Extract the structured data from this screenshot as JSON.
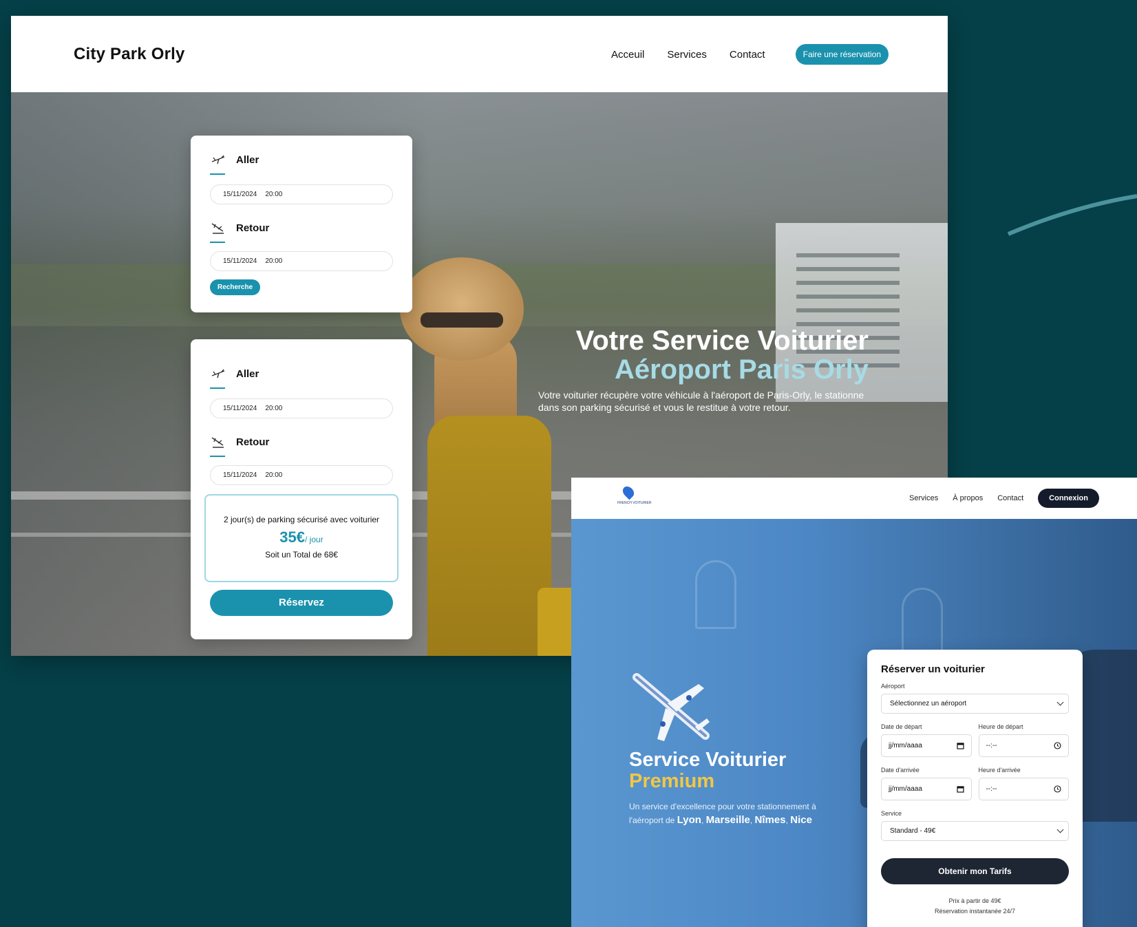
{
  "citypark": {
    "logo": "City Park Orly",
    "nav": [
      "Acceuil",
      "Services",
      "Contact"
    ],
    "cta": "Faire une réservation",
    "card1": {
      "aller_label": "Aller",
      "aller_date": "15/11/2024",
      "aller_time": "20:00",
      "retour_label": "Retour",
      "retour_date": "15/11/2024",
      "retour_time": "20:00",
      "search_button": "Recherche"
    },
    "card2": {
      "aller_label": "Aller",
      "aller_date": "15/11/2024",
      "aller_time": "20:00",
      "retour_label": "Retour",
      "retour_date": "15/11/2024",
      "retour_time": "20:00",
      "summary": "2 jour(s) de parking sécurisé avec voiturier",
      "price": "35€",
      "price_unit": "/ jour",
      "total": "Soit un Total de 68€",
      "reserve_button": "Réservez"
    },
    "hero_title_1": "Votre Service Voiturier",
    "hero_title_2": "Aéroport Paris Orly",
    "hero_subtitle": "Votre voiturier récupère votre véhicule à l'aéroport de Paris-Orly, le stationne dans son parking sécurisé et vous le restitue à votre retour.",
    "accent_color": "#1a92ad"
  },
  "frenchvoiturier": {
    "logo_text": "FRENCH VOITURIER",
    "nav": [
      "Services",
      "À propos",
      "Contact"
    ],
    "login_button": "Connexion",
    "hero_title_1": "Service Voiturier",
    "hero_title_2": "Premium",
    "hero_sub_prefix": "Un service d'excellence pour votre stationnement à l'aéroport de",
    "cities": [
      "Lyon",
      "Marseille",
      "Nîmes",
      "Nice"
    ],
    "form": {
      "title": "Réserver un voiturier",
      "airport_label": "Aéroport",
      "airport_value": "Sélectionnez un aéroport",
      "depart_date_label": "Date de départ",
      "depart_date_value": "jj/mm/aaaa",
      "depart_time_label": "Heure de départ",
      "depart_time_value": "--:--",
      "arrive_date_label": "Date d'arrivée",
      "arrive_date_value": "jj/mm/aaaa",
      "arrive_time_label": "Heure d'arrivée",
      "arrive_time_value": "--:--",
      "service_label": "Service",
      "service_value": "Standard - 49€",
      "submit_button": "Obtenir mon Tarifs",
      "footnote_1": "Prix à partir de 49€",
      "footnote_2": "Réservation instantanée 24/7"
    },
    "accent_color": "#f2c744"
  }
}
